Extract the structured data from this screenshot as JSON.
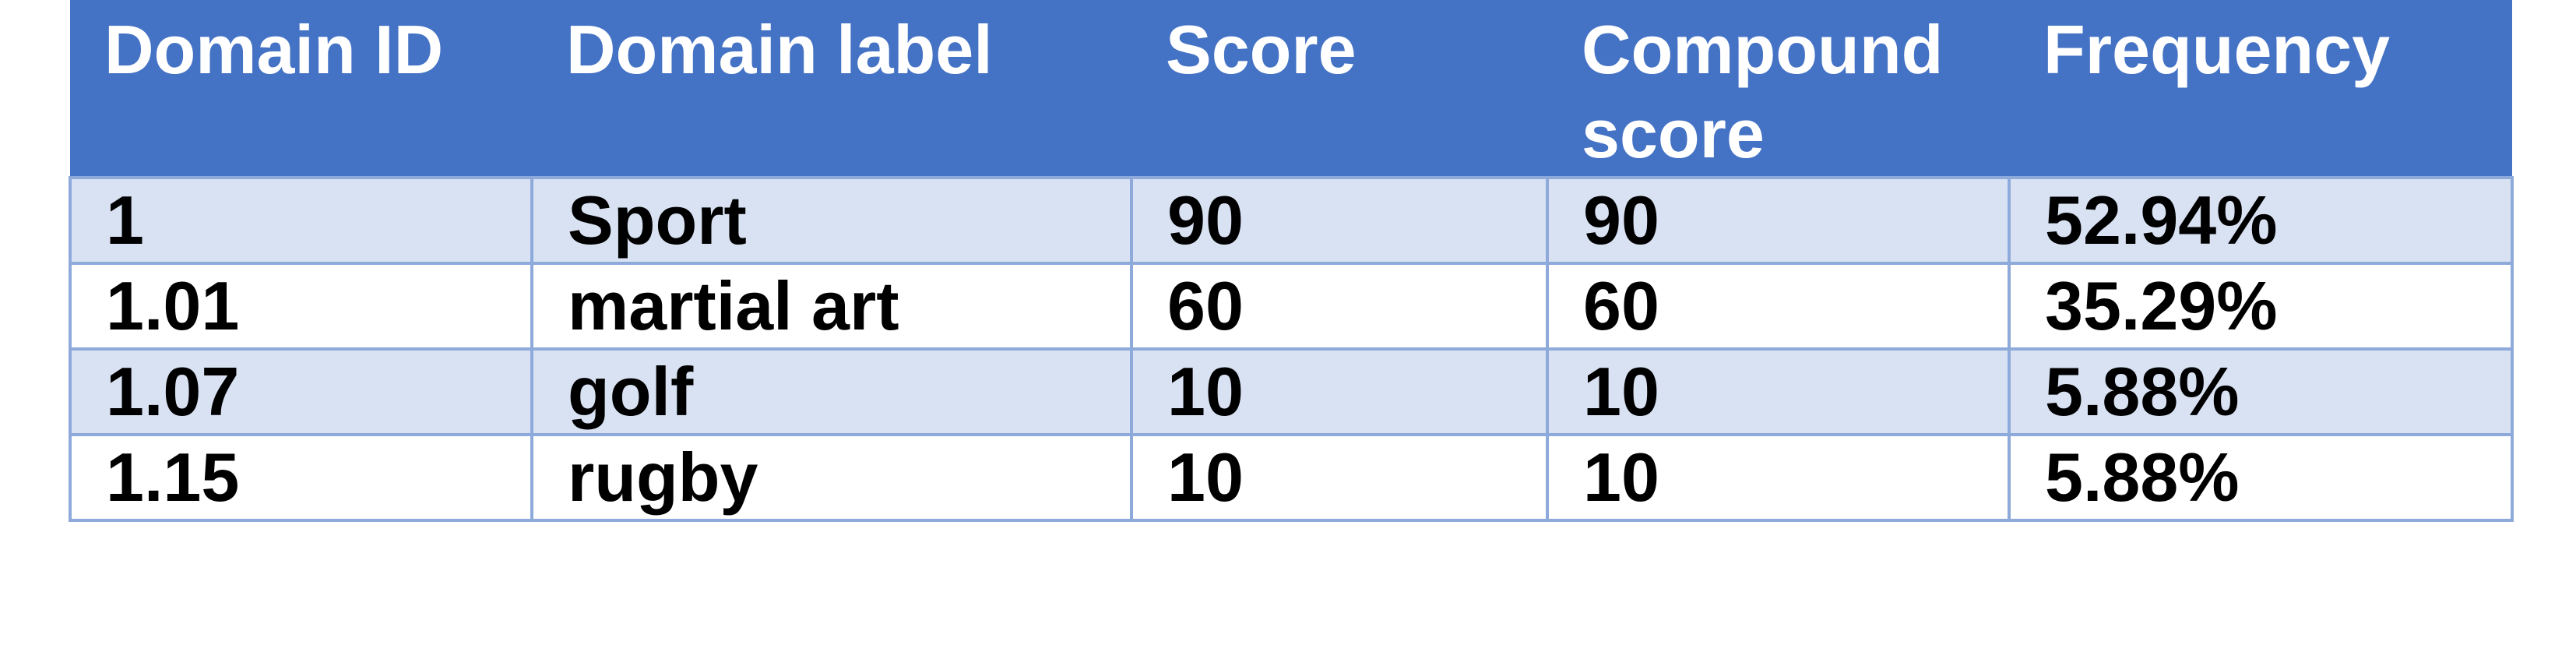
{
  "table": {
    "headers": [
      "Domain ID",
      "Domain label",
      "Score",
      "Compound score",
      "Frequency"
    ],
    "rows": [
      [
        "1",
        "Sport",
        "90",
        "90",
        "52.94%"
      ],
      [
        "1.01",
        "martial art",
        "60",
        "60",
        "35.29%"
      ],
      [
        "1.07",
        "golf",
        "10",
        "10",
        "5.88%"
      ],
      [
        "1.15",
        "rugby",
        "10",
        "10",
        "5.88%"
      ]
    ]
  },
  "colors": {
    "header_bg": "#4472c4",
    "header_text": "#ffffff",
    "band_bg": "#d9e2f3",
    "grid_line": "#8eaadb"
  }
}
